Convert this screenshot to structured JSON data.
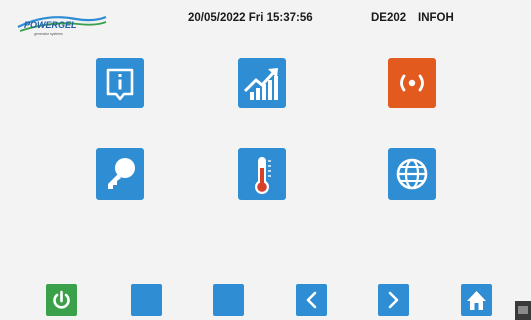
{
  "header": {
    "logo_text": "POWERGEL",
    "logo_sub": "generator systems",
    "datetime": "20/05/2022 Fri    15:37:56",
    "device": "DE202",
    "page": "INFOH"
  },
  "tiles": [
    {
      "name": "info-tile",
      "icon": "info-icon",
      "color": "#2f8dd3"
    },
    {
      "name": "statistics-tile",
      "icon": "chart-growth-icon",
      "color": "#2f8dd3"
    },
    {
      "name": "remote-tile",
      "icon": "broadcast-icon",
      "color": "#e35a1f"
    },
    {
      "name": "password-tile",
      "icon": "key-icon",
      "color": "#2f8dd3"
    },
    {
      "name": "temperature-tile",
      "icon": "thermometer-icon",
      "color": "#2f8dd3"
    },
    {
      "name": "network-tile",
      "icon": "globe-icon",
      "color": "#2f8dd3"
    }
  ],
  "footer": {
    "buttons": [
      {
        "name": "power-button",
        "icon": "power-icon",
        "color": "#3aa04a"
      },
      {
        "name": "blank-button-1",
        "icon": "",
        "color": "#2f8dd3"
      },
      {
        "name": "blank-button-2",
        "icon": "",
        "color": "#2f8dd3"
      },
      {
        "name": "previous-button",
        "icon": "chevron-left-icon",
        "color": "#2f8dd3"
      },
      {
        "name": "next-button",
        "icon": "chevron-right-icon",
        "color": "#2f8dd3"
      },
      {
        "name": "home-button",
        "icon": "home-icon",
        "color": "#2f8dd3"
      }
    ]
  }
}
